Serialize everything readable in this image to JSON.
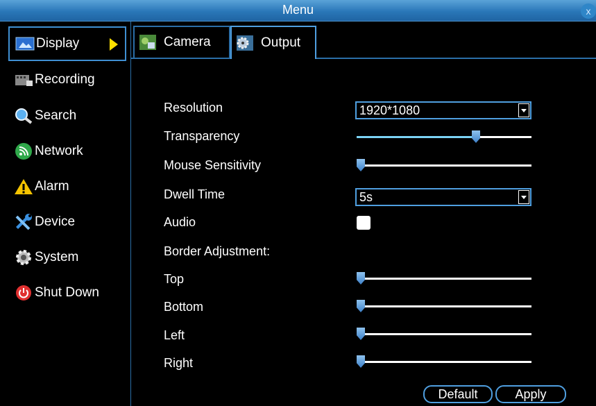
{
  "window": {
    "title": "Menu",
    "close_label": "x"
  },
  "sidebar": {
    "items": [
      {
        "label": "Display",
        "icon": "display-icon",
        "active": true
      },
      {
        "label": "Recording",
        "icon": "recording-icon"
      },
      {
        "label": "Search",
        "icon": "search-icon"
      },
      {
        "label": "Network",
        "icon": "network-icon"
      },
      {
        "label": "Alarm",
        "icon": "alarm-icon"
      },
      {
        "label": "Device",
        "icon": "device-icon"
      },
      {
        "label": "System",
        "icon": "system-icon"
      },
      {
        "label": "Shut Down",
        "icon": "power-icon"
      }
    ]
  },
  "tabs": [
    {
      "label": "Camera",
      "icon": "camera-tab-icon"
    },
    {
      "label": "Output",
      "icon": "output-tab-icon",
      "active": true
    }
  ],
  "settings": {
    "resolution": {
      "label": "Resolution",
      "value": "1920*1080"
    },
    "transparency": {
      "label": "Transparency",
      "level": 0.69
    },
    "mouse_sensitivity": {
      "label": "Mouse Sensitivity",
      "level": 0.0
    },
    "dwell_time": {
      "label": "Dwell Time",
      "value": "5s"
    },
    "audio": {
      "label": "Audio",
      "checked": false
    },
    "border_adjustment": {
      "label": "Border Adjustment:"
    },
    "top": {
      "label": "Top",
      "level": 0.0
    },
    "bottom": {
      "label": "Bottom",
      "level": 0.0
    },
    "left": {
      "label": "Left",
      "level": 0.0
    },
    "right": {
      "label": "Right",
      "level": 0.0
    }
  },
  "buttons": {
    "default": "Default",
    "apply": "Apply"
  },
  "colors": {
    "accent": "#4f9fe0",
    "active_arrow": "#ffe000",
    "slider_fill": "#7cd3f5"
  }
}
